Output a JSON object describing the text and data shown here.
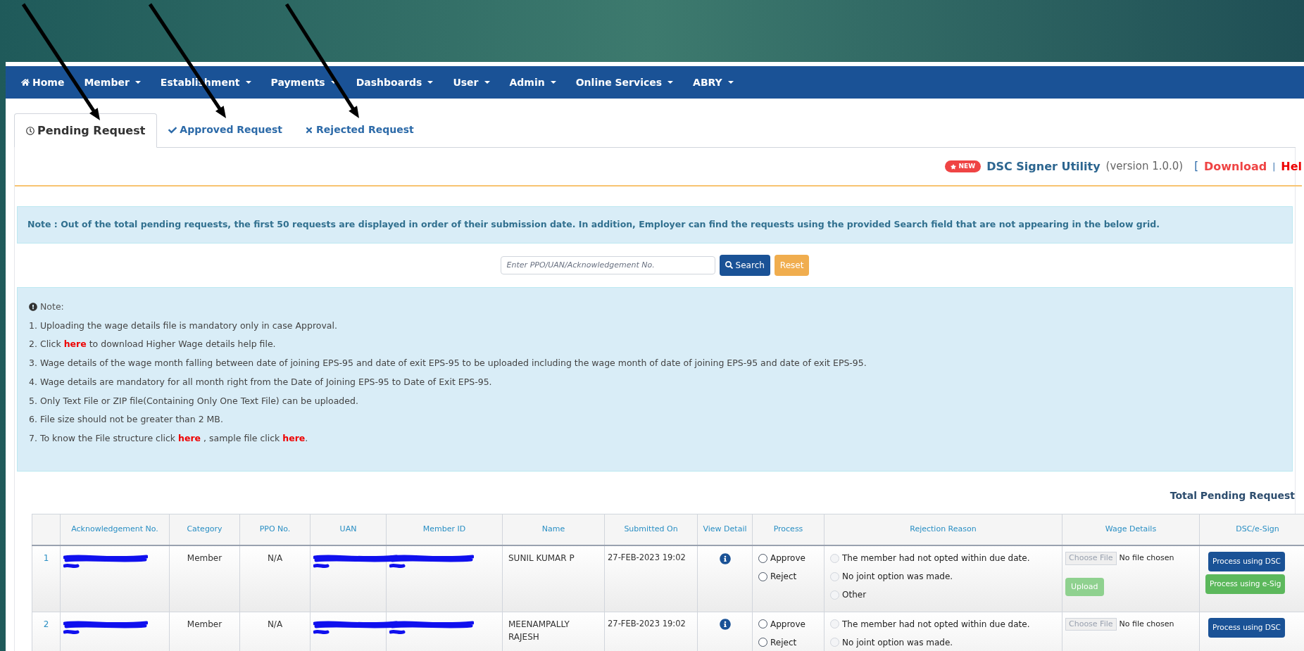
{
  "nav": [
    {
      "label": "Home",
      "dropdown": false
    },
    {
      "label": "Member",
      "dropdown": true
    },
    {
      "label": "Establishment",
      "dropdown": true
    },
    {
      "label": "Payments",
      "dropdown": true
    },
    {
      "label": "Dashboards",
      "dropdown": true
    },
    {
      "label": "User",
      "dropdown": true
    },
    {
      "label": "Admin",
      "dropdown": true
    },
    {
      "label": "Online Services",
      "dropdown": true
    },
    {
      "label": "ABRY",
      "dropdown": true
    }
  ],
  "tabs": [
    {
      "label": "Pending Request",
      "selected": true
    },
    {
      "label": "Approved Request",
      "selected": false
    },
    {
      "label": "Rejected Request",
      "selected": false
    }
  ],
  "utility": {
    "badge": "NEW",
    "title": "DSC Signer Utility",
    "version": "(version 1.0.0)",
    "open_bracket": "[",
    "download": "Download",
    "separator": "|",
    "help": "Hel"
  },
  "top_note": "Note : Out of the total pending requests, the first 50 requests are displayed in order of their submission date. In addition, Employer can find the requests using the provided Search field that are not appearing in the below grid.",
  "search": {
    "placeholder": "Enter PPO/UAN/Acknowledgement No.",
    "search_button": "Search",
    "reset_button": "Reset"
  },
  "notes": {
    "title": "Note:",
    "items": [
      "1. Uploading the wage details file is mandatory only in case Approval.",
      "2. Click **here** to download Higher Wage details help file.",
      "3. Wage details of the wage month falling between date of joining EPS-95 and date of exit EPS-95 to be uploaded including the wage month of date of joining EPS-95 and date of exit EPS-95.",
      "4. Wage details are mandatory for all month right from the Date of Joining EPS-95 to Date of Exit EPS-95.",
      "5. Only Text File or ZIP file(Containing Only One Text File) can be uploaded.",
      "6. File size should not be greater than 2 MB.",
      "7. To know the File structure click **here** , sample file click **here**."
    ]
  },
  "total_label": "Total Pending Request",
  "table": {
    "columns": [
      "Acknowledgement No.",
      "Category",
      "PPO No.",
      "UAN",
      "Member ID",
      "Name",
      "Submitted On",
      "View Detail",
      "Process",
      "Rejection Reason",
      "Wage Details",
      "DSC/e-Sign"
    ],
    "rows": [
      {
        "index": "1",
        "ack_redacted": true,
        "category": "Member",
        "ppo": "N/A",
        "uan_redacted": true,
        "member_id_redacted": true,
        "name": "SUNIL KUMAR P",
        "submitted": "27-FEB-2023 19:02",
        "process": [
          {
            "label": "Approve",
            "selected": false
          },
          {
            "label": "Reject",
            "selected": false
          }
        ],
        "reasons": [
          {
            "label": "The member had not opted within due date.",
            "disabled": true
          },
          {
            "label": "No joint option was made.",
            "disabled": true
          },
          {
            "label": "Other",
            "disabled": true
          }
        ],
        "file_button": "Choose File",
        "file_status": "No file chosen",
        "upload": {
          "label": "Upload",
          "disabled": true
        },
        "dsc_button": "Process using DSC",
        "esign_button": "Process using e-Sig"
      },
      {
        "index": "2",
        "ack_redacted": true,
        "category": "Member",
        "ppo": "N/A",
        "uan_redacted": true,
        "member_id_redacted": true,
        "name": "MEENAMPALLY RAJESH",
        "submitted": "27-FEB-2023 19:02",
        "process": [
          {
            "label": "Approve",
            "selected": false
          },
          {
            "label": "Reject",
            "selected": false
          }
        ],
        "reasons": [
          {
            "label": "The member had not opted within due date.",
            "disabled": true
          },
          {
            "label": "No joint option was made.",
            "disabled": true
          }
        ],
        "file_button": "Choose File",
        "file_status": "No file chosen",
        "dsc_button": "Process using DSC"
      }
    ]
  }
}
